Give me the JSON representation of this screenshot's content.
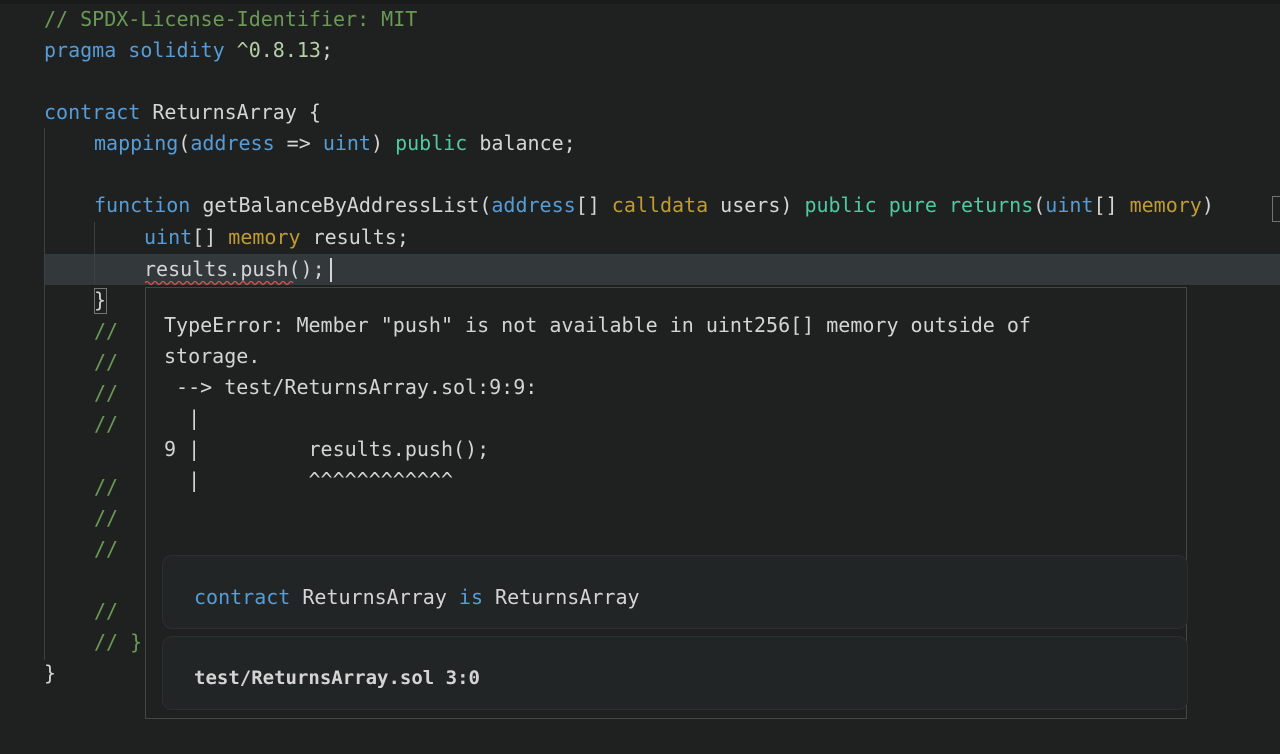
{
  "code": {
    "line1": "// SPDX-License-Identifier: MIT",
    "line2_kw": "pragma",
    "line2_kw2": "solidity",
    "line2_ver": "^0.8.13",
    "line2_end": ";",
    "line4_kw": "contract",
    "line4_name": " ReturnsArray {",
    "line5_fn": "mapping",
    "line5_p1": "(",
    "line5_addr": "address",
    "line5_arrow": " => ",
    "line5_uint": "uint",
    "line5_p2": ") ",
    "line5_public": "public",
    "line5_rest": " balance;",
    "line7_fn": "function",
    "line7_name": " getBalanceByAddressList(",
    "line7_addr": "address",
    "line7_br": "[] ",
    "line7_calldata": "calldata",
    "line7_users": " users) ",
    "line7_public": "public",
    "line7_sp": " ",
    "line7_pure": "pure",
    "line7_sp2": " ",
    "line7_returns": "returns",
    "line7_p": "(",
    "line7_uint": "uint",
    "line7_br2": "[] ",
    "line7_memory": "memory",
    "line7_end": ")",
    "line8_uint": "uint",
    "line8_br": "[] ",
    "line8_memory": "memory",
    "line8_rest": " results;",
    "line9": "results.push();",
    "line10": "}",
    "comment_slash": "//",
    "comment_close": "// }",
    "closing_brace": "}"
  },
  "hover": {
    "diagnostic": "TypeError: Member \"push\" is not available in uint256[] memory outside of\nstorage.\n --> test/ReturnsArray.sol:9:9:\n  |\n9 |         results.push();\n  |         ^^^^^^^^^^^^",
    "sig_kw": "contract",
    "sig_name": " ReturnsArray ",
    "sig_is": "is",
    "sig_base": " ReturnsArray",
    "location": "test/ReturnsArray.sol 3:0"
  },
  "colors": {
    "background": "#1f2121",
    "keyword": "#569cd6",
    "comment": "#6a9955",
    "storage_location": "#c09b2f",
    "control": "#3fc7a5",
    "error_squiggle": "#e05252"
  }
}
